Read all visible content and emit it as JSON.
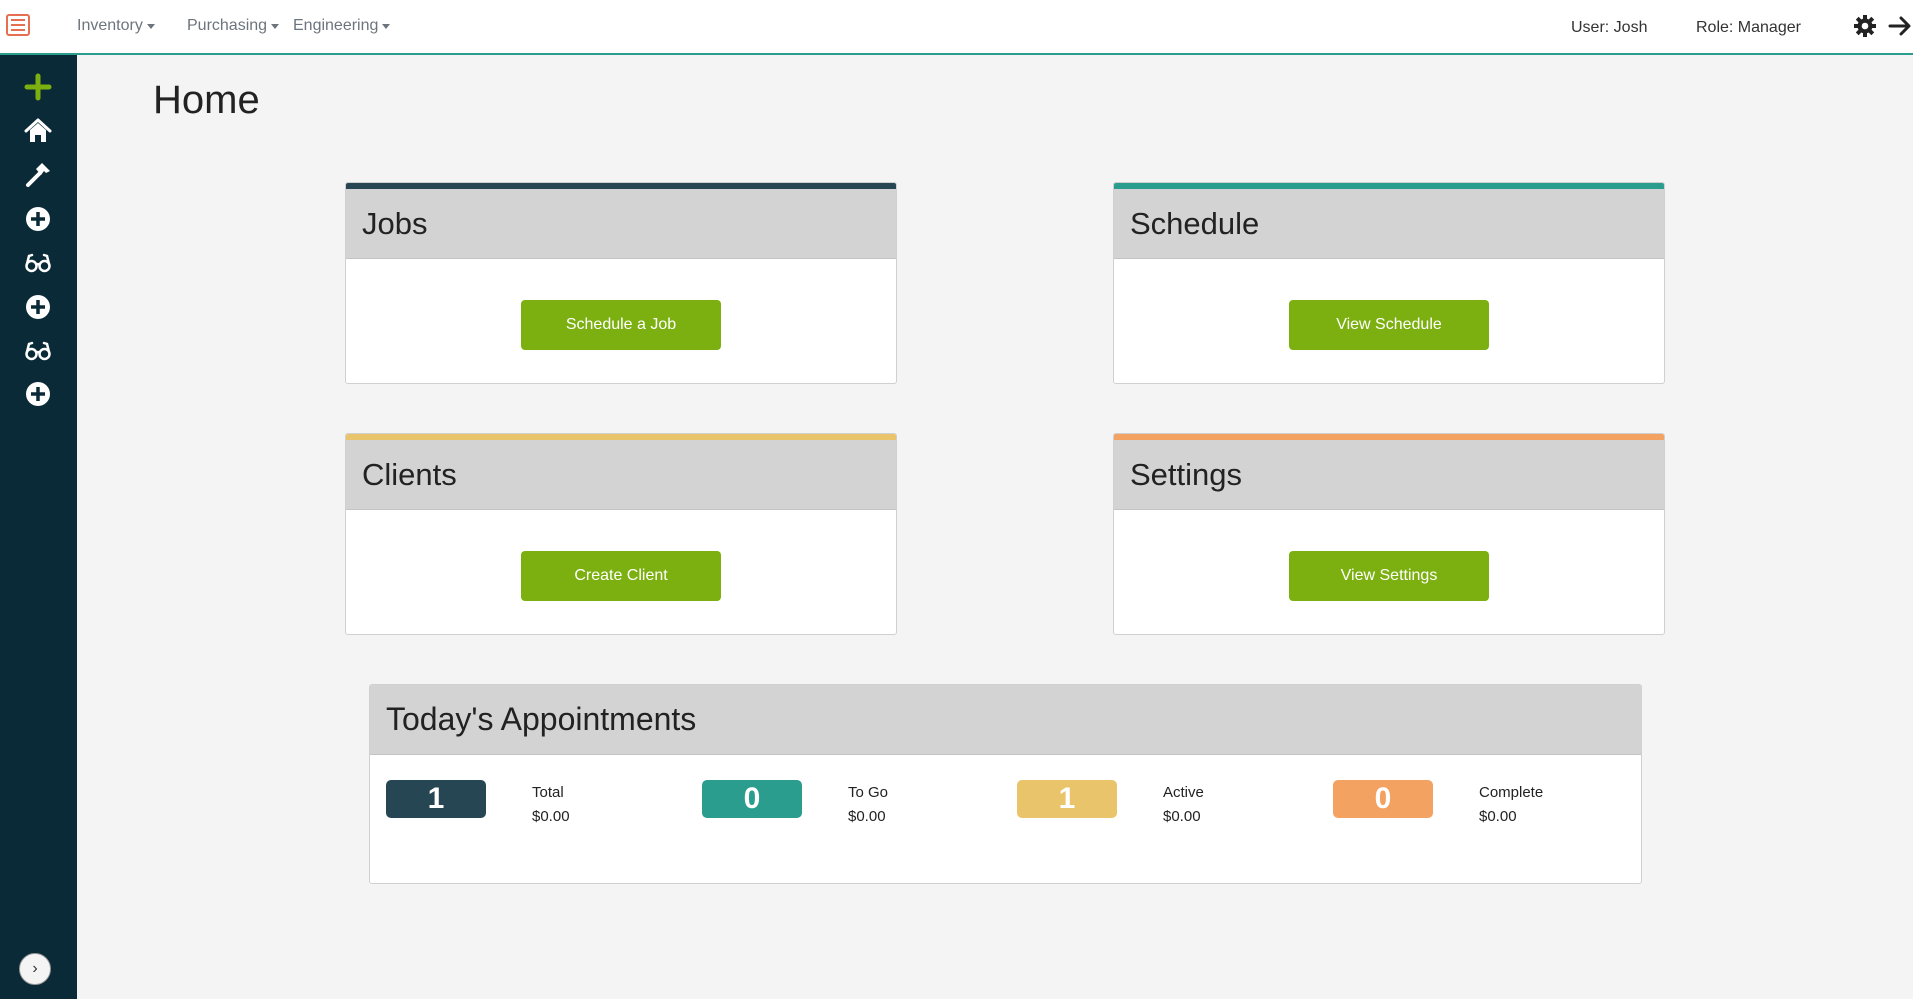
{
  "nav": {
    "menus": [
      {
        "label": "Inventory"
      },
      {
        "label": "Purchasing"
      },
      {
        "label": "Engineering"
      }
    ],
    "user": "User: Josh",
    "role": "Role: Manager"
  },
  "sidebar": {
    "icons": [
      "plus-icon",
      "home-icon",
      "hammer-icon",
      "plus-circle-icon",
      "glasses-icon",
      "plus-circle-icon",
      "glasses-icon",
      "plus-circle-icon"
    ],
    "collapse_glyph": "›"
  },
  "page": {
    "title": "Home"
  },
  "cards": [
    {
      "title": "Jobs",
      "button": "Schedule a Job",
      "accent": "#264653"
    },
    {
      "title": "Schedule",
      "button": "View Schedule",
      "accent": "#2a9d8f"
    },
    {
      "title": "Clients",
      "button": "Create Client",
      "accent": "#e9c46a"
    },
    {
      "title": "Settings",
      "button": "View Settings",
      "accent": "#f4a261"
    }
  ],
  "appointments": {
    "title": "Today's Appointments",
    "stats": [
      {
        "count": "1",
        "label": "Total",
        "amount": "$0.00",
        "color": "#264653"
      },
      {
        "count": "0",
        "label": "To Go",
        "amount": "$0.00",
        "color": "#2a9d8f"
      },
      {
        "count": "1",
        "label": "Active",
        "amount": "$0.00",
        "color": "#e9c46a"
      },
      {
        "count": "0",
        "label": "Complete",
        "amount": "$0.00",
        "color": "#f4a261"
      }
    ]
  },
  "colors": {
    "primary_button": "#7cb010",
    "sidebar_bg": "#0b2a38",
    "nav_border": "#2a9d8f",
    "hamburger": "#e76f51"
  }
}
